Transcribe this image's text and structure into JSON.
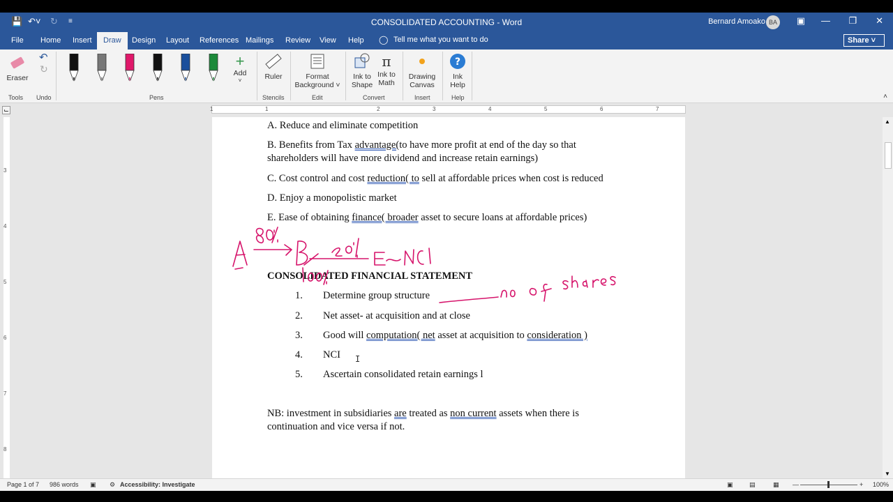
{
  "titlebar": {
    "doc_title": "CONSOLIDATED ACCOUNTING - Word",
    "user_name": "Bernard Amoako",
    "avatar_initials": "BA"
  },
  "tabs": [
    "File",
    "Home",
    "Insert",
    "Draw",
    "Design",
    "Layout",
    "References",
    "Mailings",
    "Review",
    "View",
    "Help"
  ],
  "tell_me": "Tell me what you want to do",
  "share_label": "Share",
  "ribbon": {
    "eraser": "Eraser",
    "add": "Add",
    "ruler": "Ruler",
    "format_background_1": "Format",
    "format_background_2": "Background",
    "ink_to_shape_1": "Ink to",
    "ink_to_shape_2": "Shape",
    "ink_to_math_1": "Ink to",
    "ink_to_math_2": "Math",
    "drawing_canvas_1": "Drawing",
    "drawing_canvas_2": "Canvas",
    "ink_help_1": "Ink",
    "ink_help_2": "Help",
    "groups": {
      "tools": "Tools",
      "undo": "Undo",
      "pens": "Pens",
      "stencils": "Stencils",
      "edit": "Edit",
      "convert": "Convert",
      "insert": "Insert",
      "help": "Help"
    },
    "pen_colors": [
      "#111111",
      "#777777",
      "#e0186a",
      "#111111",
      "#1a4f9c",
      "#1c8a3a"
    ]
  },
  "ruler": {
    "h_numbers": [
      "1",
      "1",
      "2",
      "3",
      "4",
      "5",
      "6",
      "7"
    ],
    "v_numbers": [
      "3",
      "4",
      "5",
      "6",
      "7",
      "8"
    ]
  },
  "document": {
    "line_a": "A. Reduce and eliminate competition",
    "line_b1_pre": "B. Benefits from Tax ",
    "line_b1_ul": "advantage(",
    "line_b1_post": "to have more profit at end of the day so that",
    "line_b2": "shareholders will have more dividend and increase retain earnings)",
    "line_c_pre": "C. Cost control and cost ",
    "line_c_ul": "reduction( to",
    "line_c_post": " sell at affordable prices when cost is reduced",
    "line_d": "D. Enjoy a monopolistic market",
    "line_e_pre": "E. Ease of obtaining ",
    "line_e_ul": "finance( broader",
    "line_e_post": " asset to secure loans at affordable prices)",
    "heading": "CONSOLIDATED FINANCIAL STATEMENT",
    "list": [
      {
        "num": "1.",
        "text": "Determine group structure"
      },
      {
        "num": "2.",
        "text": "Net asset- at acquisition and at close"
      },
      {
        "num": "3.",
        "pre": "Good will ",
        "ul1": "computation( net",
        "mid": " asset at acquisition to ",
        "ul2": "consideration )"
      },
      {
        "num": "4.",
        "text": "NCI"
      },
      {
        "num": "5.",
        "text": "Ascertain consolidated retain earnings l"
      }
    ],
    "nb1_pre": "NB: investment in subsidiaries ",
    "nb1_ul1": "are",
    "nb1_mid": " treated as ",
    "nb1_ul2": "non current",
    "nb1_post": " assets when there is",
    "nb2": "continuation and vice versa if not."
  },
  "ink_color": "#d6146b",
  "statusbar": {
    "page": "Page 1 of 7",
    "words": "986 words",
    "accessibility": "Accessibility: Investigate",
    "zoom": "100%"
  }
}
